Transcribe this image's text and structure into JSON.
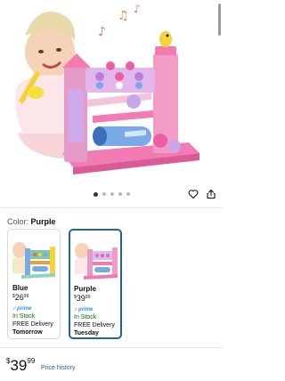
{
  "product_image": {
    "alt_icon": "product-photo",
    "colors": {
      "pink": "#f27bb3",
      "purple": "#c9a6ea",
      "blue": "#7aa9e8"
    }
  },
  "carousel": {
    "count": 5,
    "active_index": 0
  },
  "actions": {
    "favorite_icon": "heart-icon",
    "share_icon": "share-icon"
  },
  "color_selector": {
    "label": "Color:",
    "value": "Purple"
  },
  "variants": [
    {
      "name": "Blue",
      "currency": "$",
      "price_whole": "26",
      "price_frac": "99",
      "prime": "prime",
      "stock": "In Stock",
      "delivery": "FREE Delivery",
      "when": "Tomorrow",
      "selected": false
    },
    {
      "name": "Purple",
      "currency": "$",
      "price_whole": "39",
      "price_frac": "99",
      "prime": "prime",
      "stock": "In Stock",
      "delivery": "FREE Delivery",
      "when": "Tuesday",
      "selected": true
    }
  ],
  "main_price": {
    "currency": "$",
    "whole": "39",
    "fraction": "99"
  },
  "price_history_link": "Price history",
  "theme": {
    "accent_blue": "#2162a1",
    "in_stock_green": "#007600",
    "prime_blue": "#1a98ff"
  }
}
